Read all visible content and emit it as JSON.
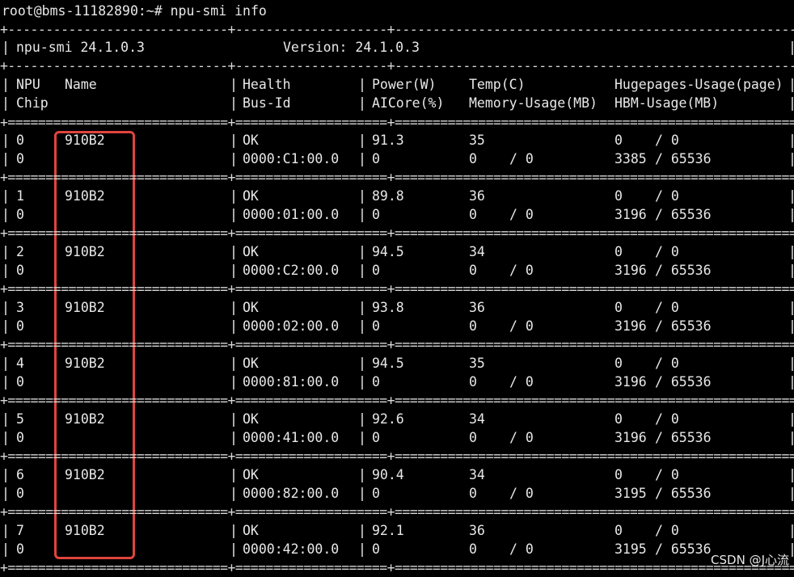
{
  "prompt": {
    "text": "root@bms-11182890:~# npu-smi info"
  },
  "banner": {
    "tool": "npu-smi 24.1.0.3",
    "version": "Version: 24.1.0.3"
  },
  "headers": {
    "npu": "NPU",
    "name": "Name",
    "health": "Health",
    "power": "Power(W)",
    "temp": "Temp(C)",
    "hugepages": "Hugepages-Usage(page)",
    "chip": "Chip",
    "busid": "Bus-Id",
    "aicore": "AICore(%)",
    "memory": "Memory-Usage(MB)",
    "hbm": "HBM-Usage(MB)"
  },
  "npus": [
    {
      "npu": "0",
      "name": "910B2",
      "health": "OK",
      "power": "91.3",
      "temp": "35",
      "hp_used": "0",
      "hp_total": "/ 0",
      "chip": "0",
      "busid": "0000:C1:00.0",
      "aicore": "0",
      "mem_used": "0",
      "mem_total": "/ 0",
      "hbm_used": "3385",
      "hbm_total": "/ 65536"
    },
    {
      "npu": "1",
      "name": "910B2",
      "health": "OK",
      "power": "89.8",
      "temp": "36",
      "hp_used": "0",
      "hp_total": "/ 0",
      "chip": "0",
      "busid": "0000:01:00.0",
      "aicore": "0",
      "mem_used": "0",
      "mem_total": "/ 0",
      "hbm_used": "3196",
      "hbm_total": "/ 65536"
    },
    {
      "npu": "2",
      "name": "910B2",
      "health": "OK",
      "power": "94.5",
      "temp": "34",
      "hp_used": "0",
      "hp_total": "/ 0",
      "chip": "0",
      "busid": "0000:C2:00.0",
      "aicore": "0",
      "mem_used": "0",
      "mem_total": "/ 0",
      "hbm_used": "3196",
      "hbm_total": "/ 65536"
    },
    {
      "npu": "3",
      "name": "910B2",
      "health": "OK",
      "power": "93.8",
      "temp": "36",
      "hp_used": "0",
      "hp_total": "/ 0",
      "chip": "0",
      "busid": "0000:02:00.0",
      "aicore": "0",
      "mem_used": "0",
      "mem_total": "/ 0",
      "hbm_used": "3196",
      "hbm_total": "/ 65536"
    },
    {
      "npu": "4",
      "name": "910B2",
      "health": "OK",
      "power": "94.5",
      "temp": "35",
      "hp_used": "0",
      "hp_total": "/ 0",
      "chip": "0",
      "busid": "0000:81:00.0",
      "aicore": "0",
      "mem_used": "0",
      "mem_total": "/ 0",
      "hbm_used": "3196",
      "hbm_total": "/ 65536"
    },
    {
      "npu": "5",
      "name": "910B2",
      "health": "OK",
      "power": "92.6",
      "temp": "34",
      "hp_used": "0",
      "hp_total": "/ 0",
      "chip": "0",
      "busid": "0000:41:00.0",
      "aicore": "0",
      "mem_used": "0",
      "mem_total": "/ 0",
      "hbm_used": "3196",
      "hbm_total": "/ 65536"
    },
    {
      "npu": "6",
      "name": "910B2",
      "health": "OK",
      "power": "90.4",
      "temp": "34",
      "hp_used": "0",
      "hp_total": "/ 0",
      "chip": "0",
      "busid": "0000:82:00.0",
      "aicore": "0",
      "mem_used": "0",
      "mem_total": "/ 0",
      "hbm_used": "3195",
      "hbm_total": "/ 65536"
    },
    {
      "npu": "7",
      "name": "910B2",
      "health": "OK",
      "power": "92.1",
      "temp": "36",
      "hp_used": "0",
      "hp_total": "/ 0",
      "chip": "0",
      "busid": "0000:42:00.0",
      "aicore": "0",
      "mem_used": "0",
      "mem_total": "/ 0",
      "hbm_used": "3195",
      "hbm_total": "/ 65536"
    }
  ],
  "watermark": {
    "text": "CSDN @J心流"
  },
  "colors": {
    "background": "#000000",
    "text": "#e8e8e8",
    "highlight": "#e0443e"
  }
}
